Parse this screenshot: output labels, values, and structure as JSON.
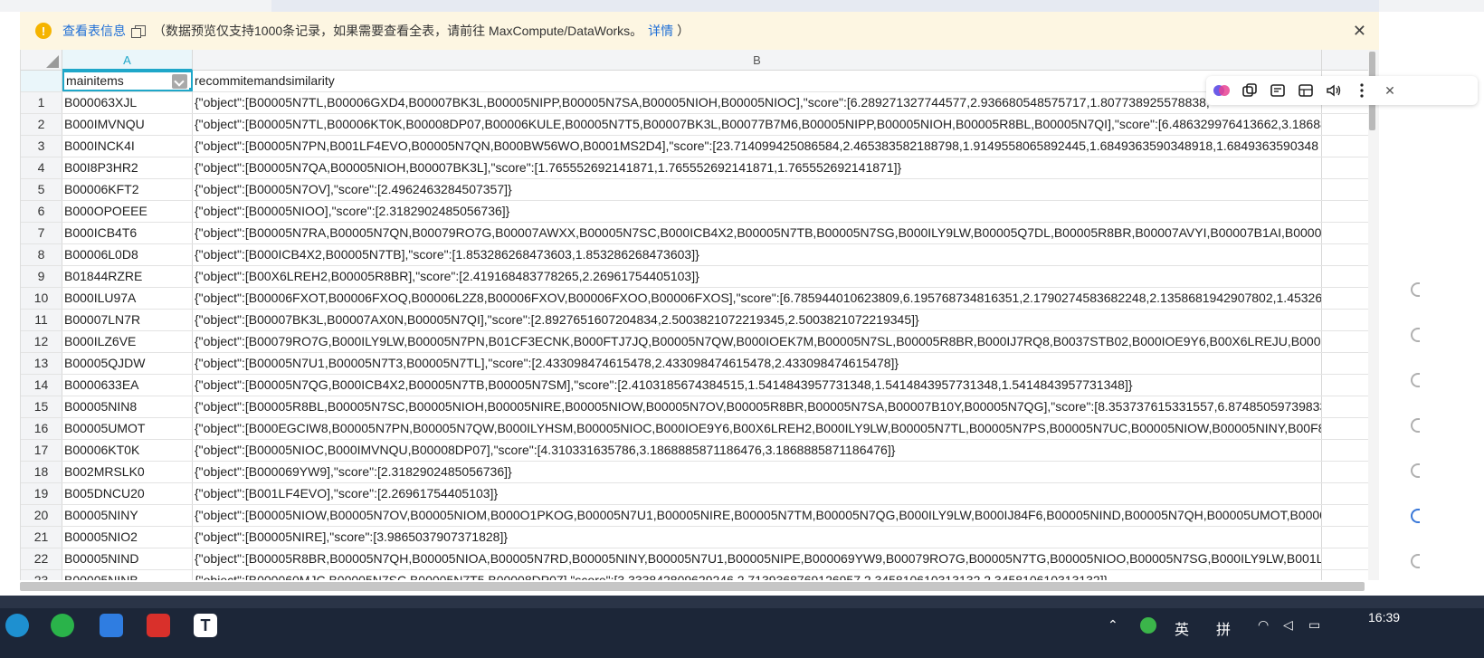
{
  "notice": {
    "link_label": "查看表信息",
    "message": "（数据预览仅支持1000条记录，如果需要查看全表，请前往 MaxCompute/DataWorks。",
    "details_label": "详情",
    "close_paren": "）"
  },
  "grid": {
    "column_letters": [
      "A",
      "B"
    ],
    "headers": [
      "mainitems",
      "recommitemandsimilarity"
    ],
    "rows": [
      {
        "n": "1",
        "a": "B000063XJL",
        "b": "{\"object\":[B00005N7TL,B00006GXD4,B00007BK3L,B00005NIPP,B00005N7SA,B00005NIOH,B00005NIOC],\"score\":[6.289271327744577,2.936680548575717,1.807738925578838,"
      },
      {
        "n": "2",
        "a": "B000IMVNQU",
        "b": "{\"object\":[B00005N7TL,B00006KT0K,B00008DP07,B00006KULE,B00005N7T5,B00007BK3L,B00077B7M6,B00005NIPP,B00005NIOH,B00005R8BL,B00005N7QI],\"score\":[6.486329976413662,3.18688"
      },
      {
        "n": "3",
        "a": "B000INCK4I",
        "b": "{\"object\":[B00005N7PN,B001LF4EVO,B00005N7QN,B000BW56WO,B0001MS2D4],\"score\":[23.714099425086584,2.465383582188798,1.9149558065892445,1.6849363590348918,1.6849363590348"
      },
      {
        "n": "4",
        "a": "B00I8P3HR2",
        "b": "{\"object\":[B00005N7QA,B00005NIOH,B00007BK3L],\"score\":[1.765552692141871,1.765552692141871,1.765552692141871]}"
      },
      {
        "n": "5",
        "a": "B00006KFT2",
        "b": "{\"object\":[B00005N7OV],\"score\":[2.4962463284507357]}"
      },
      {
        "n": "6",
        "a": "B000OPOEEE",
        "b": "{\"object\":[B00005NIOO],\"score\":[2.3182902485056736]}"
      },
      {
        "n": "7",
        "a": "B000ICB4T6",
        "b": "{\"object\":[B00005N7RA,B00005N7QN,B00079RO7G,B00007AWXX,B00005N7SC,B000ICB4X2,B00005N7TB,B00005N7SG,B000ILY9LW,B00005Q7DL,B00005R8BR,B00007AVYI,B00007B1AI,B00007IJZ"
      },
      {
        "n": "8",
        "a": "B00006L0D8",
        "b": "{\"object\":[B000ICB4X2,B00005N7TB],\"score\":[1.853286268473603,1.853286268473603]}"
      },
      {
        "n": "9",
        "a": "B01844RZRE",
        "b": "{\"object\":[B00X6LREH2,B00005R8BR],\"score\":[2.419168483778265,2.26961754405103]}"
      },
      {
        "n": "10",
        "a": "B000ILU97A",
        "b": "{\"object\":[B00006FXOT,B00006FXOQ,B00006L2Z8,B00006FXOV,B00006FXOO,B00006FXOS],\"score\":[6.785944010623809,6.195768734816351,2.1790274583682248,2.1358681942907802,1.45326"
      },
      {
        "n": "11",
        "a": "B00007LN7R",
        "b": "{\"object\":[B00007BK3L,B00007AX0N,B00005N7QI],\"score\":[2.8927651607204834,2.5003821072219345,2.5003821072219345]}"
      },
      {
        "n": "12",
        "a": "B000ILZ6VE",
        "b": "{\"object\":[B00079RO7G,B000ILY9LW,B00005N7PN,B01CF3ECNK,B000FTJ7JQ,B00005N7QW,B000IOEK7M,B00005N7SL,B00005R8BR,B000IJ7RQ8,B0037STB02,B000IOE9Y6,B00X6LREJU,B00005N7C"
      },
      {
        "n": "13",
        "a": "B00005QJDW",
        "b": "{\"object\":[B00005N7U1,B00005N7T3,B00005N7TL],\"score\":[2.433098474615478,2.433098474615478,2.433098474615478]}"
      },
      {
        "n": "14",
        "a": "B0000633EA",
        "b": "{\"object\":[B00005N7QG,B000ICB4X2,B00005N7TB,B00005N7SM],\"score\":[2.4103185674384515,1.5414843957731348,1.5414843957731348,1.5414843957731348]}"
      },
      {
        "n": "15",
        "a": "B00005NIN8",
        "b": "{\"object\":[B00005R8BL,B00005N7SC,B00005NIOH,B00005NIRE,B00005NIOW,B00005N7OV,B00005R8BR,B00005N7SA,B00007B10Y,B00005N7QG],\"score\":[8.353737615331557,6.874850597398335"
      },
      {
        "n": "16",
        "a": "B00005UMOT",
        "b": "{\"object\":[B000EGCIW8,B00005N7PN,B00005N7QW,B000ILYHSM,B00005NIOC,B000IOE9Y6,B00X6LREH2,B000ILY9LW,B00005N7TL,B00005N7PS,B00005N7UC,B00005NIOW,B00005NINY,B00F8LWD"
      },
      {
        "n": "17",
        "a": "B00006KT0K",
        "b": "{\"object\":[B00005NIOC,B000IMVNQU,B00008DP07],\"score\":[4.310331635786,3.1868885871186476,3.1868885871186476]}"
      },
      {
        "n": "18",
        "a": "B002MRSLK0",
        "b": "{\"object\":[B000069YW9],\"score\":[2.3182902485056736]}"
      },
      {
        "n": "19",
        "a": "B005DNCU20",
        "b": "{\"object\":[B001LF4EVO],\"score\":[2.26961754405103]}"
      },
      {
        "n": "20",
        "a": "B00005NINY",
        "b": "{\"object\":[B00005NIOW,B00005N7OV,B00005NIOM,B000O1PKOG,B00005N7U1,B00005NIRE,B00005N7TM,B00005N7QG,B000ILY9LW,B000IJ84F6,B00005NIND,B00005N7QH,B00005UMOT,B00005N"
      },
      {
        "n": "21",
        "a": "B00005NIO2",
        "b": "{\"object\":[B00005NIRE],\"score\":[3.9865037907371828]}"
      },
      {
        "n": "22",
        "a": "B00005NIND",
        "b": "{\"object\":[B00005R8BR,B00005N7QH,B00005NIOA,B00005N7RD,B00005NINY,B00005N7U1,B00005NIPE,B000069YW9,B00079RO7G,B00005N7TG,B00005NIOO,B00005N7SG,B000ILY9LW,B001LF4E"
      },
      {
        "n": "23",
        "a": "B00005NINB",
        "b": "{\"object\":[B000060MJC,B00005N7SC,B00005N7T5,B00008DP07],\"score\":[3.333842809629246,2.7139368769126957,2.345810610313132,2.345810610313132]}"
      }
    ]
  },
  "taskbar": {
    "time": "16:39",
    "ime_lang": "英",
    "ime_mode": "拼"
  }
}
